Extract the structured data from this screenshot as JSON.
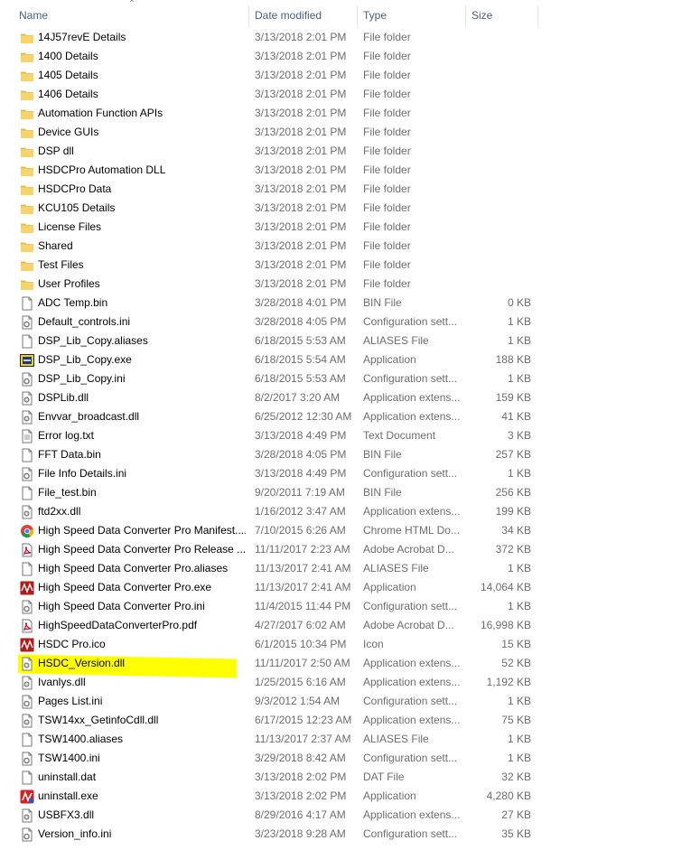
{
  "columns": {
    "name": "Name",
    "date": "Date modified",
    "type": "Type",
    "size": "Size"
  },
  "colors": {
    "folder": "#f7d36b",
    "highlight": "#ffff00",
    "header_text": "#4c607a",
    "detail_text": "#6d6d6d"
  },
  "files": [
    {
      "name": "14J57revE Details",
      "date": "3/13/2018 2:01 PM",
      "type": "File folder",
      "size": "",
      "icon": "folder-icon"
    },
    {
      "name": "1400 Details",
      "date": "3/13/2018 2:01 PM",
      "type": "File folder",
      "size": "",
      "icon": "folder-icon"
    },
    {
      "name": "1405 Details",
      "date": "3/13/2018 2:01 PM",
      "type": "File folder",
      "size": "",
      "icon": "folder-icon"
    },
    {
      "name": "1406 Details",
      "date": "3/13/2018 2:01 PM",
      "type": "File folder",
      "size": "",
      "icon": "folder-icon"
    },
    {
      "name": "Automation Function APIs",
      "date": "3/13/2018 2:01 PM",
      "type": "File folder",
      "size": "",
      "icon": "folder-icon"
    },
    {
      "name": "Device GUIs",
      "date": "3/13/2018 2:01 PM",
      "type": "File folder",
      "size": "",
      "icon": "folder-icon"
    },
    {
      "name": "DSP dll",
      "date": "3/13/2018 2:01 PM",
      "type": "File folder",
      "size": "",
      "icon": "folder-icon"
    },
    {
      "name": "HSDCPro Automation DLL",
      "date": "3/13/2018 2:01 PM",
      "type": "File folder",
      "size": "",
      "icon": "folder-icon"
    },
    {
      "name": "HSDCPro Data",
      "date": "3/13/2018 2:01 PM",
      "type": "File folder",
      "size": "",
      "icon": "folder-icon"
    },
    {
      "name": "KCU105 Details",
      "date": "3/13/2018 2:01 PM",
      "type": "File folder",
      "size": "",
      "icon": "folder-icon"
    },
    {
      "name": "License Files",
      "date": "3/13/2018 2:01 PM",
      "type": "File folder",
      "size": "",
      "icon": "folder-icon"
    },
    {
      "name": "Shared",
      "date": "3/13/2018 2:01 PM",
      "type": "File folder",
      "size": "",
      "icon": "folder-icon"
    },
    {
      "name": "Test Files",
      "date": "3/13/2018 2:01 PM",
      "type": "File folder",
      "size": "",
      "icon": "folder-icon"
    },
    {
      "name": "User Profiles",
      "date": "3/13/2018 2:01 PM",
      "type": "File folder",
      "size": "",
      "icon": "folder-icon"
    },
    {
      "name": "ADC Temp.bin",
      "date": "3/28/2018 4:01 PM",
      "type": "BIN File",
      "size": "0 KB",
      "icon": "file-icon"
    },
    {
      "name": "Default_controls.ini",
      "date": "3/28/2018 4:05 PM",
      "type": "Configuration sett...",
      "size": "1 KB",
      "icon": "config-file-icon"
    },
    {
      "name": "DSP_Lib_Copy.aliases",
      "date": "6/18/2015 5:53 AM",
      "type": "ALIASES File",
      "size": "1 KB",
      "icon": "file-icon"
    },
    {
      "name": "DSP_Lib_Copy.exe",
      "date": "6/18/2015 5:54 AM",
      "type": "Application",
      "size": "188 KB",
      "icon": "labview-app-icon"
    },
    {
      "name": "DSP_Lib_Copy.ini",
      "date": "6/18/2015 5:53 AM",
      "type": "Configuration sett...",
      "size": "1 KB",
      "icon": "config-file-icon"
    },
    {
      "name": "DSPLib.dll",
      "date": "8/2/2017 3:20 AM",
      "type": "Application extens...",
      "size": "159 KB",
      "icon": "dll-file-icon"
    },
    {
      "name": "Envvar_broadcast.dll",
      "date": "6/25/2012 12:30 AM",
      "type": "Application extens...",
      "size": "41 KB",
      "icon": "dll-file-icon"
    },
    {
      "name": "Error log.txt",
      "date": "3/13/2018 4:49 PM",
      "type": "Text Document",
      "size": "3 KB",
      "icon": "text-file-icon"
    },
    {
      "name": "FFT Data.bin",
      "date": "3/28/2018 4:05 PM",
      "type": "BIN File",
      "size": "257 KB",
      "icon": "file-icon"
    },
    {
      "name": "File Info Details.ini",
      "date": "3/13/2018 4:49 PM",
      "type": "Configuration sett...",
      "size": "1 KB",
      "icon": "config-file-icon"
    },
    {
      "name": "File_test.bin",
      "date": "9/20/2011 7:19 AM",
      "type": "BIN File",
      "size": "256 KB",
      "icon": "file-icon"
    },
    {
      "name": "ftd2xx.dll",
      "date": "1/16/2012 3:47 AM",
      "type": "Application extens...",
      "size": "199 KB",
      "icon": "dll-file-icon"
    },
    {
      "name": "High Speed Data Converter Pro Manifest....",
      "date": "7/10/2015 6:26 AM",
      "type": "Chrome HTML Do...",
      "size": "34 KB",
      "icon": "chrome-icon"
    },
    {
      "name": "High Speed Data Converter Pro Release ...",
      "date": "11/11/2017 2:23 AM",
      "type": "Adobe Acrobat D...",
      "size": "372 KB",
      "icon": "pdf-icon"
    },
    {
      "name": "High Speed Data Converter Pro.aliases",
      "date": "11/13/2017 2:41 AM",
      "type": "ALIASES File",
      "size": "1 KB",
      "icon": "file-icon"
    },
    {
      "name": "High Speed Data Converter Pro.exe",
      "date": "11/13/2017 2:41 AM",
      "type": "Application",
      "size": "14,064 KB",
      "icon": "hsdc-app-icon"
    },
    {
      "name": "High Speed Data Converter Pro.ini",
      "date": "11/4/2015 11:44 PM",
      "type": "Configuration sett...",
      "size": "1 KB",
      "icon": "config-file-icon"
    },
    {
      "name": "HighSpeedDataConverterPro.pdf",
      "date": "4/27/2017 6:02 AM",
      "type": "Adobe Acrobat D...",
      "size": "16,998 KB",
      "icon": "pdf-icon"
    },
    {
      "name": "HSDC Pro.ico",
      "date": "6/1/2015 10:34 PM",
      "type": "Icon",
      "size": "15 KB",
      "icon": "hsdc-app-icon"
    },
    {
      "name": "HSDC_Version.dll",
      "date": "11/11/2017 2:50 AM",
      "type": "Application extens...",
      "size": "52 KB",
      "icon": "dll-file-icon"
    },
    {
      "name": "Ivanlys.dll",
      "date": "1/25/2015 6:16 AM",
      "type": "Application extens...",
      "size": "1,192 KB",
      "icon": "dll-file-icon"
    },
    {
      "name": "Pages List.ini",
      "date": "9/3/2012 1:54 AM",
      "type": "Configuration sett...",
      "size": "1 KB",
      "icon": "config-file-icon"
    },
    {
      "name": "TSW14xx_GetinfoCdll.dll",
      "date": "6/17/2015 12:23 AM",
      "type": "Application extens...",
      "size": "75 KB",
      "icon": "dll-file-icon"
    },
    {
      "name": "TSW1400.aliases",
      "date": "11/13/2017 2:37 AM",
      "type": "ALIASES File",
      "size": "1 KB",
      "icon": "file-icon"
    },
    {
      "name": "TSW1400.ini",
      "date": "3/29/2018 8:42 AM",
      "type": "Configuration sett...",
      "size": "1 KB",
      "icon": "config-file-icon"
    },
    {
      "name": "uninstall.dat",
      "date": "3/13/2018 2:02 PM",
      "type": "DAT File",
      "size": "32 KB",
      "icon": "file-icon"
    },
    {
      "name": "uninstall.exe",
      "date": "3/13/2018 2:02 PM",
      "type": "Application",
      "size": "4,280 KB",
      "icon": "uninstall-app-icon"
    },
    {
      "name": "USBFX3.dll",
      "date": "8/29/2016 4:17 AM",
      "type": "Application extens...",
      "size": "27 KB",
      "icon": "dll-file-icon"
    },
    {
      "name": "Version_info.ini",
      "date": "3/23/2018 9:28 AM",
      "type": "Configuration sett...",
      "size": "35 KB",
      "icon": "config-file-icon"
    }
  ]
}
